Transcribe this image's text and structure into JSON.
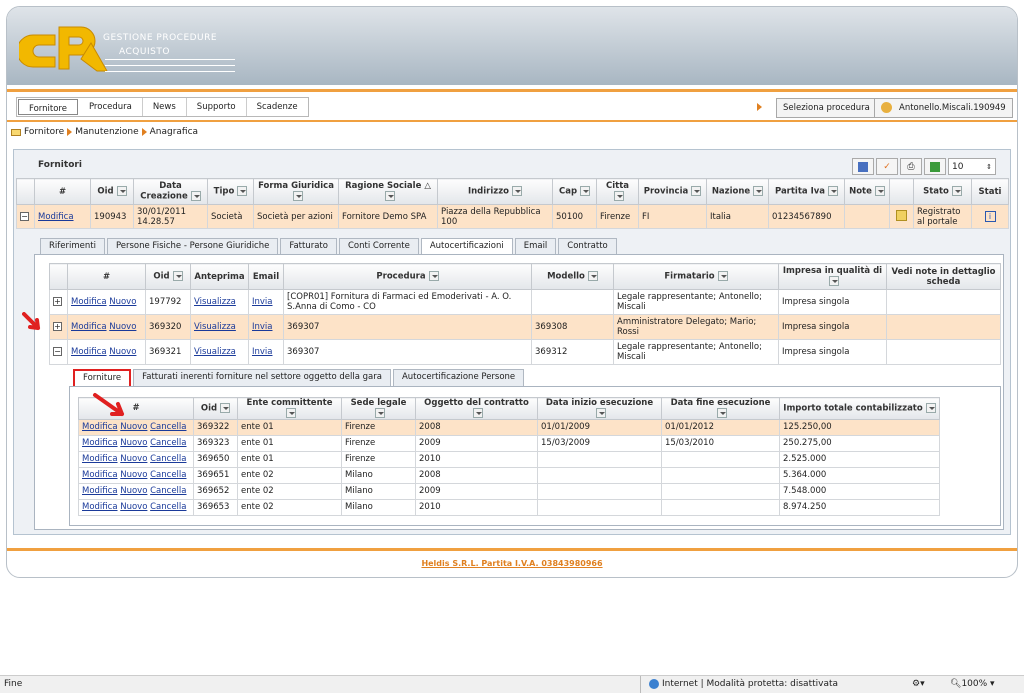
{
  "brand": {
    "line1": "GESTIONE PROCEDURE",
    "line2": "ACQUISTO"
  },
  "nav": [
    "Fornitore",
    "Procedura",
    "News",
    "Supporto",
    "Scadenze"
  ],
  "select_proc": "Seleziona procedura",
  "user": "Antonello.Miscali.190949",
  "breadcrumb": [
    "Fornitore",
    "Manutenzione",
    "Anagrafica"
  ],
  "panel_title": "Fornitori",
  "page_size": "10",
  "main_headers": [
    "#",
    "Oid",
    "Data Creazione",
    "Tipo",
    "Forma Giuridica",
    "Ragione Sociale",
    "Indirizzo",
    "Cap",
    "Citta",
    "Provincia",
    "Nazione",
    "Partita Iva",
    "Note",
    "",
    "Stato",
    "Stati"
  ],
  "main_row": {
    "action": "Modifica",
    "oid": "190943",
    "date": "30/01/2011 14.28.57",
    "tipo": "Società",
    "forma": "Società per azioni",
    "ragione": "Fornitore Demo SPA",
    "indirizzo": "Piazza della Repubblica 100",
    "cap": "50100",
    "citta": "Firenze",
    "prov": "FI",
    "nazione": "Italia",
    "piva": "01234567890",
    "stato": "Registrato al portale"
  },
  "tabs1": [
    "Riferimenti",
    "Persone Fisiche - Persone Giuridiche",
    "Fatturato",
    "Conti Corrente",
    "Autocertificazioni",
    "Email",
    "Contratto"
  ],
  "auto_headers": [
    "#",
    "Oid",
    "Anteprima",
    "Email",
    "Procedura",
    "Modello",
    "Firmatario",
    "Impresa in qualità di",
    "Vedi note in dettaglio scheda"
  ],
  "auto_rows": [
    {
      "exp": "+",
      "mod": "Modifica",
      "nuovo": "Nuovo",
      "oid": "197792",
      "ante": "Visualizza",
      "email": "Invia",
      "proc": "[COPR01] Fornitura di Farmaci ed Emoderivati - A. O. S.Anna di Como - CO",
      "modello": "",
      "firm": "Legale rappresentante; Antonello; Miscali",
      "imp": "Impresa singola"
    },
    {
      "exp": "+",
      "mod": "Modifica",
      "nuovo": "Nuovo",
      "oid": "369320",
      "ante": "Visualizza",
      "email": "Invia",
      "proc": "369307",
      "modello": "369308",
      "firm": "Amministratore Delegato; Mario; Rossi",
      "imp": "Impresa singola"
    },
    {
      "exp": "−",
      "mod": "Modifica",
      "nuovo": "Nuovo",
      "oid": "369321",
      "ante": "Visualizza",
      "email": "Invia",
      "proc": "369307",
      "modello": "369312",
      "firm": "Legale rappresentante; Antonello; Miscali",
      "imp": "Impresa singola"
    }
  ],
  "tabs2": [
    "Forniture",
    "Fatturati inerenti forniture nel settore oggetto della gara",
    "Autocertificazione Persone"
  ],
  "forn_headers": [
    "#",
    "Oid",
    "Ente committente",
    "Sede legale",
    "Oggetto del contratto",
    "Data inizio esecuzione",
    "Data fine esecuzione",
    "Importo totale contabilizzato"
  ],
  "forn_actions": {
    "mod": "Modifica",
    "nuovo": "Nuovo",
    "canc": "Cancella"
  },
  "forn_rows": [
    {
      "oid": "369322",
      "ente": "ente 01",
      "sede": "Firenze",
      "ogg": "2008",
      "ini": "01/01/2009",
      "fine": "01/01/2012",
      "imp": "125.250,00"
    },
    {
      "oid": "369323",
      "ente": "ente 01",
      "sede": "Firenze",
      "ogg": "2009",
      "ini": "15/03/2009",
      "fine": "15/03/2010",
      "imp": "250.275,00"
    },
    {
      "oid": "369650",
      "ente": "ente 01",
      "sede": "Firenze",
      "ogg": "2010",
      "ini": "",
      "fine": "",
      "imp": "2.525.000"
    },
    {
      "oid": "369651",
      "ente": "ente 02",
      "sede": "Milano",
      "ogg": "2008",
      "ini": "",
      "fine": "",
      "imp": "5.364.000"
    },
    {
      "oid": "369652",
      "ente": "ente 02",
      "sede": "Milano",
      "ogg": "2009",
      "ini": "",
      "fine": "",
      "imp": "7.548.000"
    },
    {
      "oid": "369653",
      "ente": "ente 02",
      "sede": "Milano",
      "ogg": "2010",
      "ini": "",
      "fine": "",
      "imp": "8.974.250"
    }
  ],
  "footer": "Heldis S.R.L. Partita I.V.A. 03843980966",
  "status": {
    "left": "Fine",
    "zone": "Internet | Modalità protetta: disattivata",
    "zoom": "100%"
  },
  "colors": {
    "orange": "#f0a040",
    "selected_row": "#fde3c8",
    "arrow_red": "#e02020"
  }
}
